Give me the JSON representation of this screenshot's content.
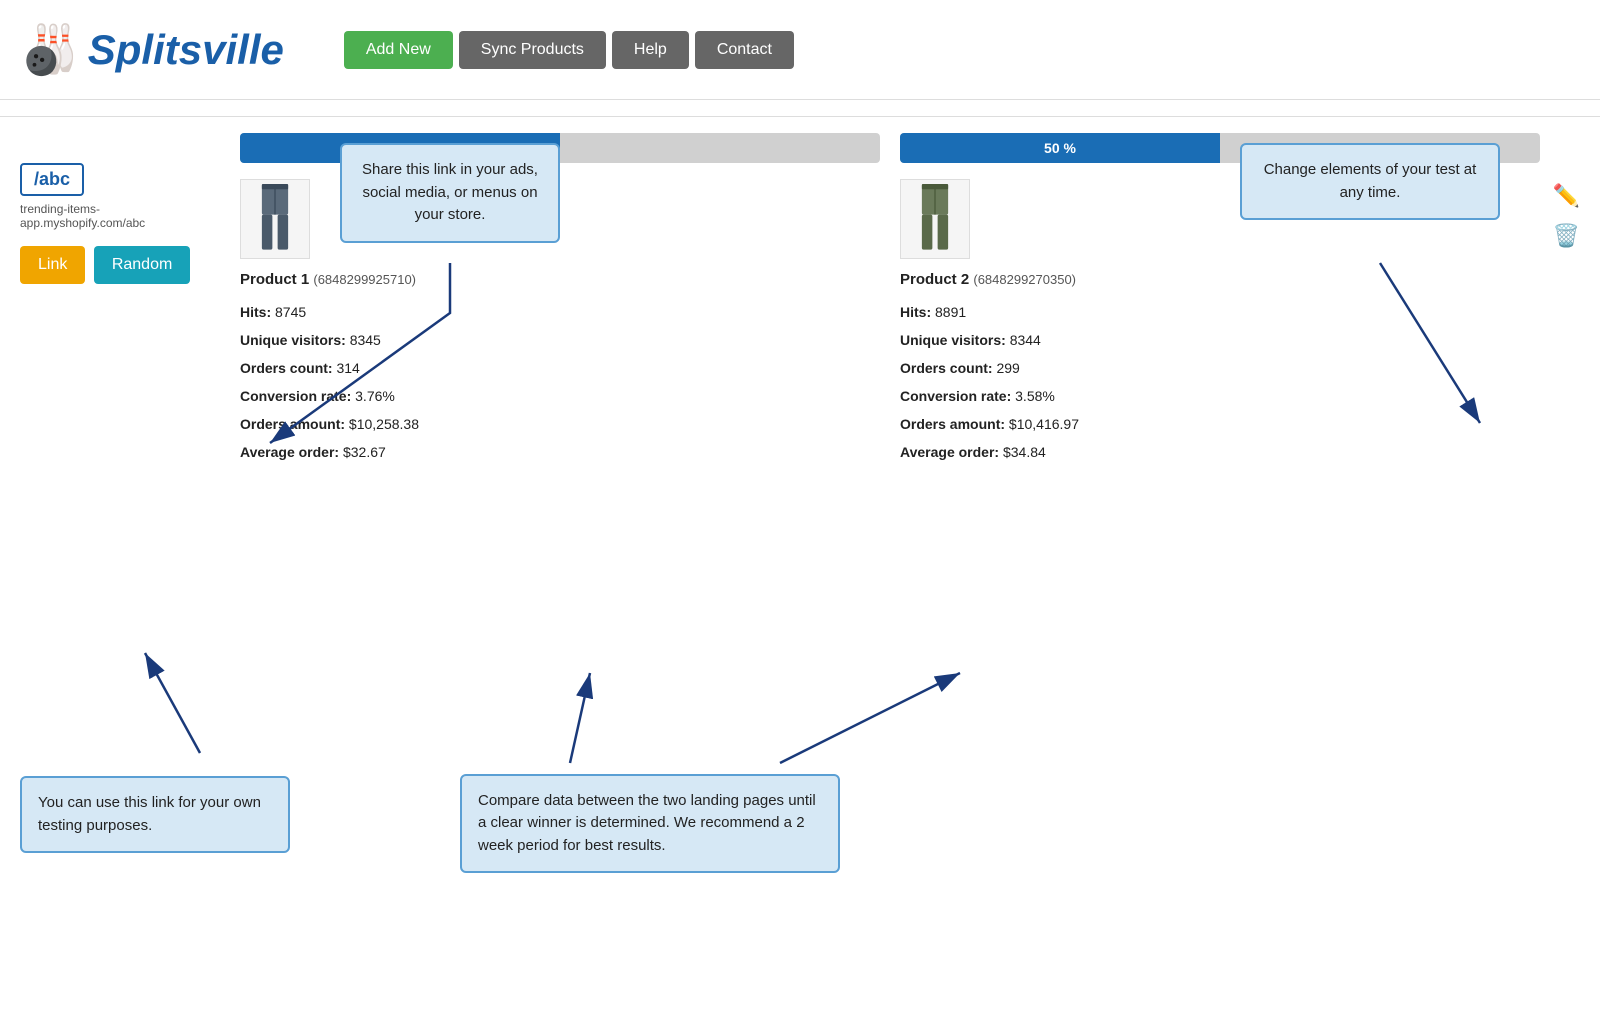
{
  "logo": {
    "text": "Splitsville",
    "icon": "🎳"
  },
  "nav": {
    "add_new": "Add New",
    "sync_products": "Sync Products",
    "help": "Help",
    "contact": "Contact"
  },
  "left": {
    "badge": "/abc",
    "url": "trending-items-app.myshopify.com/abc",
    "btn_link": "Link",
    "btn_random": "Random"
  },
  "product1": {
    "progress": "50 %",
    "progress_pct": 50,
    "title": "Product 1",
    "id": "(6848299925710)",
    "hits": "8745",
    "unique_visitors": "8345",
    "orders_count": "314",
    "conversion_rate": "3.76%",
    "orders_amount": "$10,258.38",
    "average_order": "$32.67"
  },
  "product2": {
    "progress": "50 %",
    "progress_pct": 50,
    "title": "Product 2",
    "id": "(6848299270350)",
    "hits": "8891",
    "unique_visitors": "8344",
    "orders_count": "299",
    "conversion_rate": "3.58%",
    "orders_amount": "$10,416.97",
    "average_order": "$34.84"
  },
  "callouts": {
    "top_center": "Share this link in your ads, social media, or menus on your store.",
    "top_right": "Change elements of your test at any time.",
    "bottom_left": "You can use this link for your own testing purposes.",
    "bottom_center": "Compare data between the two landing pages until a clear winner is determined. We recommend a 2 week period for best results."
  },
  "stats_labels": {
    "hits": "Hits:",
    "unique_visitors": "Unique visitors:",
    "orders_count": "Orders count:",
    "conversion_rate": "Conversion rate:",
    "orders_amount": "Orders amount:",
    "average_order": "Average order:"
  }
}
